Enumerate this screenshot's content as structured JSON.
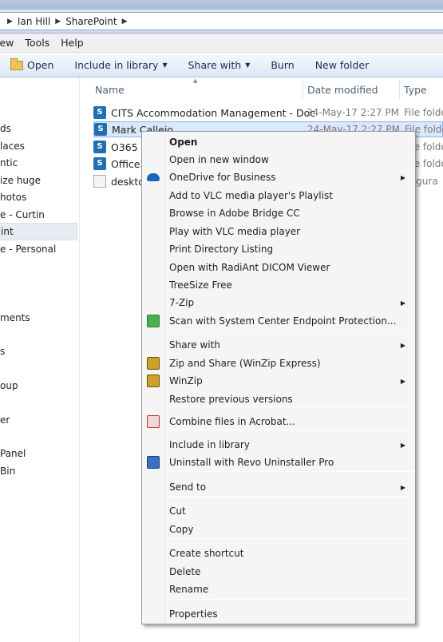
{
  "breadcrumb": {
    "segments": [
      "Ian Hill",
      "SharePoint"
    ]
  },
  "menubar": {
    "items": [
      "iew",
      "Tools",
      "Help"
    ]
  },
  "toolbar": {
    "open": "Open",
    "include_in_library": "Include in library",
    "share_with": "Share with",
    "burn": "Burn",
    "new_folder": "New folder"
  },
  "nav": {
    "items": [
      "ds",
      "laces",
      "ntic",
      "ize huge",
      "hotos",
      "e - Curtin",
      "int",
      "e - Personal",
      "ments",
      "s",
      "oup",
      "er",
      "Panel",
      "Bin"
    ],
    "selected_index": 6
  },
  "columns": {
    "name": "Name",
    "date_modified": "Date modified",
    "type": "Type"
  },
  "files": [
    {
      "name": "CITS Accommodation Management - Doc",
      "date": "24-May-17 2:27 PM",
      "type": "File folde",
      "icon": "sharepoint-icon"
    },
    {
      "name": "Mark Callejo",
      "date": "24-May-17 2:27 PM",
      "type": "File folde",
      "icon": "sharepoint-icon"
    },
    {
      "name": "O365 L",
      "date": "",
      "type": "File folde",
      "icon": "sharepoint-icon"
    },
    {
      "name": "Office3",
      "date": "",
      "type": "File folde",
      "icon": "sharepoint-icon"
    },
    {
      "name": "deskto",
      "date": "",
      "type": "nfigura",
      "icon": "settings-file-icon"
    }
  ],
  "context_menu": {
    "items": [
      {
        "label": "Open",
        "bold": true,
        "submenu": false
      },
      {
        "label": "Open in new window",
        "submenu": false
      },
      {
        "label": "OneDrive for Business",
        "submenu": true,
        "icon": "onedrive-cloud-icon"
      },
      {
        "label": "Add to VLC media player's Playlist",
        "submenu": false
      },
      {
        "label": "Browse in Adobe Bridge CC",
        "submenu": false
      },
      {
        "label": "Play with VLC media player",
        "submenu": false
      },
      {
        "label": "Print Directory Listing",
        "submenu": false
      },
      {
        "label": "Open with RadiAnt DICOM Viewer",
        "submenu": false
      },
      {
        "label": "TreeSize Free",
        "submenu": false
      },
      {
        "label": "7-Zip",
        "submenu": true
      },
      {
        "label": "Scan with System Center Endpoint Protection...",
        "submenu": false,
        "icon": "endpoint-protection-icon"
      },
      {
        "label": "Share with",
        "submenu": true
      },
      {
        "label": "Zip and Share (WinZip Express)",
        "submenu": false,
        "icon": "winzip-icon"
      },
      {
        "label": "WinZip",
        "submenu": true,
        "icon": "winzip-icon"
      },
      {
        "label": "Restore previous versions",
        "submenu": false
      },
      {
        "label": "Combine files in Acrobat...",
        "submenu": false,
        "icon": "acrobat-icon"
      },
      {
        "label": "Include in library",
        "submenu": true
      },
      {
        "label": "Uninstall with Revo Uninstaller Pro",
        "submenu": false,
        "icon": "revo-uninstaller-icon"
      },
      {
        "label": "Send to",
        "submenu": true
      },
      {
        "label": "Cut",
        "submenu": false
      },
      {
        "label": "Copy",
        "submenu": false
      },
      {
        "label": "Create shortcut",
        "submenu": false
      },
      {
        "label": "Delete",
        "submenu": false
      },
      {
        "label": "Rename",
        "submenu": false
      },
      {
        "label": "Properties",
        "submenu": false
      }
    ],
    "submenu_glyph": "▶"
  }
}
